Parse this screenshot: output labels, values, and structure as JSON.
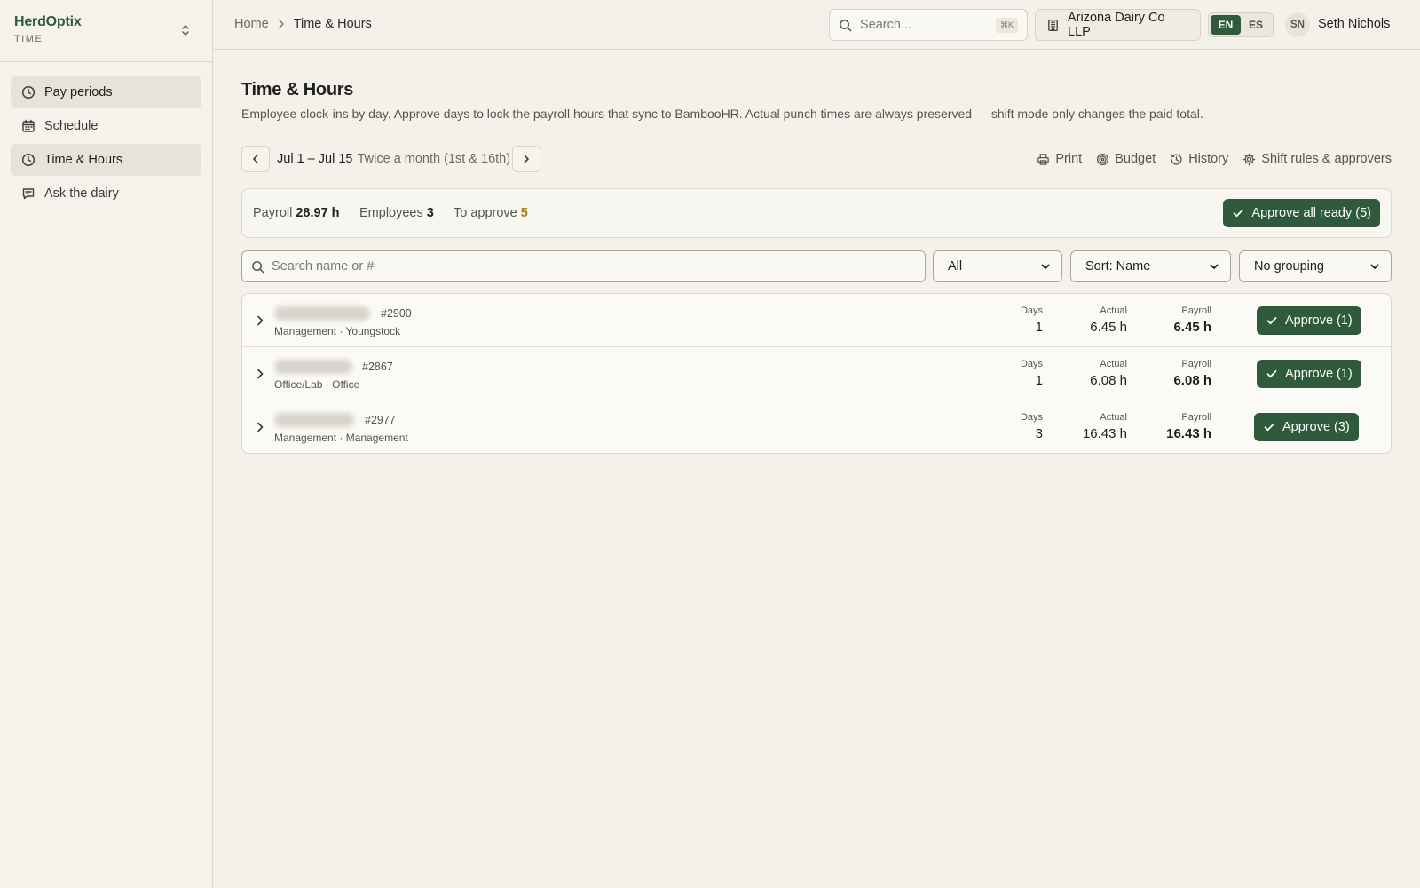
{
  "app": {
    "name": "HerdOptix",
    "module": "TIME"
  },
  "sidebar": {
    "items": [
      {
        "label": "Pay periods",
        "icon": "clock-icon"
      },
      {
        "label": "Schedule",
        "icon": "calendar-icon"
      },
      {
        "label": "Time & Hours",
        "icon": "clock-icon",
        "active": true
      },
      {
        "label": "Ask the dairy",
        "icon": "chat-icon"
      }
    ]
  },
  "header": {
    "breadcrumb": {
      "home": "Home",
      "current": "Time & Hours"
    },
    "search": {
      "placeholder": "Search...",
      "shortcut": "⌘K"
    },
    "organization": "Arizona Dairy Co LLP",
    "languages": [
      "EN",
      "ES"
    ],
    "active_language": "EN",
    "user": {
      "initials": "SN",
      "name": "Seth Nichols"
    }
  },
  "page": {
    "title": "Time & Hours",
    "description": "Employee clock-ins by day. Approve days to lock the payroll hours that sync to BambooHR. Actual punch times are always preserved — shift mode only changes the paid total.",
    "period": {
      "label": "Jul 1 – Jul 15",
      "frequency": "· Twice a month (1st & 16th)"
    },
    "actions": [
      "Print",
      "Budget",
      "History",
      "Shift rules & approvers"
    ]
  },
  "summary": {
    "payroll_label": "Payroll",
    "payroll_value": "28.97 h",
    "employees_label": "Employees",
    "employees_value": "3",
    "to_approve_label": "To approve",
    "to_approve_value": "5",
    "approve_all_label": "Approve all ready (5)"
  },
  "filters": {
    "search_placeholder": "Search name or #",
    "status": "All",
    "sort": "Sort: Name",
    "grouping": "No grouping"
  },
  "columns": {
    "days": "Days",
    "actual": "Actual",
    "payroll": "Payroll"
  },
  "employees": [
    {
      "number": "#2900",
      "meta": "Management · Youngstock",
      "days": "1",
      "actual": "6.45 h",
      "payroll": "6.45 h",
      "approve": "Approve (1)"
    },
    {
      "number": "#2867",
      "meta": "Office/Lab · Office",
      "days": "1",
      "actual": "6.08 h",
      "payroll": "6.08 h",
      "approve": "Approve (1)"
    },
    {
      "number": "#2977",
      "meta": "Management · Management",
      "days": "3",
      "actual": "16.43 h",
      "payroll": "16.43 h",
      "approve": "Approve (3)"
    }
  ],
  "colors": {
    "brand": "#2f5a3c",
    "warning": "#a77d10",
    "background": "#f4f1ea"
  }
}
